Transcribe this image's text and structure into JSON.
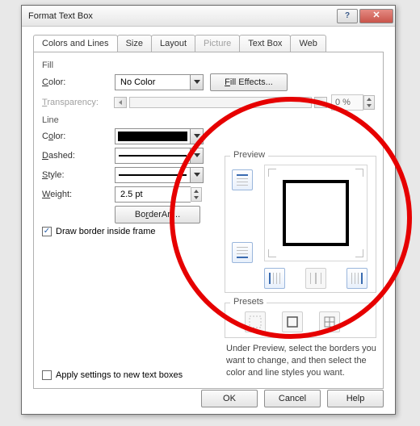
{
  "window": {
    "title": "Format Text Box"
  },
  "tabs": {
    "colors_lines": "Colors and Lines",
    "size": "Size",
    "layout": "Layout",
    "picture": "Picture",
    "text_box": "Text Box",
    "web": "Web"
  },
  "fill": {
    "section": "Fill",
    "color_label": "Color:",
    "color_value": "No Color",
    "effects_btn": "Fill Effects...",
    "transparency_label": "Transparency:",
    "transparency_value": "0 %"
  },
  "line": {
    "section": "Line",
    "color_label": "Color:",
    "dashed_label": "Dashed:",
    "style_label": "Style:",
    "weight_label": "Weight:",
    "weight_value": "2.5 pt",
    "borderart_btn": "BorderArt...",
    "draw_inside": "Draw border inside frame"
  },
  "preview": {
    "section": "Preview",
    "presets": "Presets",
    "hint": "Under Preview, select the borders you want to change, and then select the color and line styles you want."
  },
  "footer": {
    "apply_new": "Apply settings to new text boxes",
    "ok": "OK",
    "cancel": "Cancel",
    "help": "Help"
  }
}
